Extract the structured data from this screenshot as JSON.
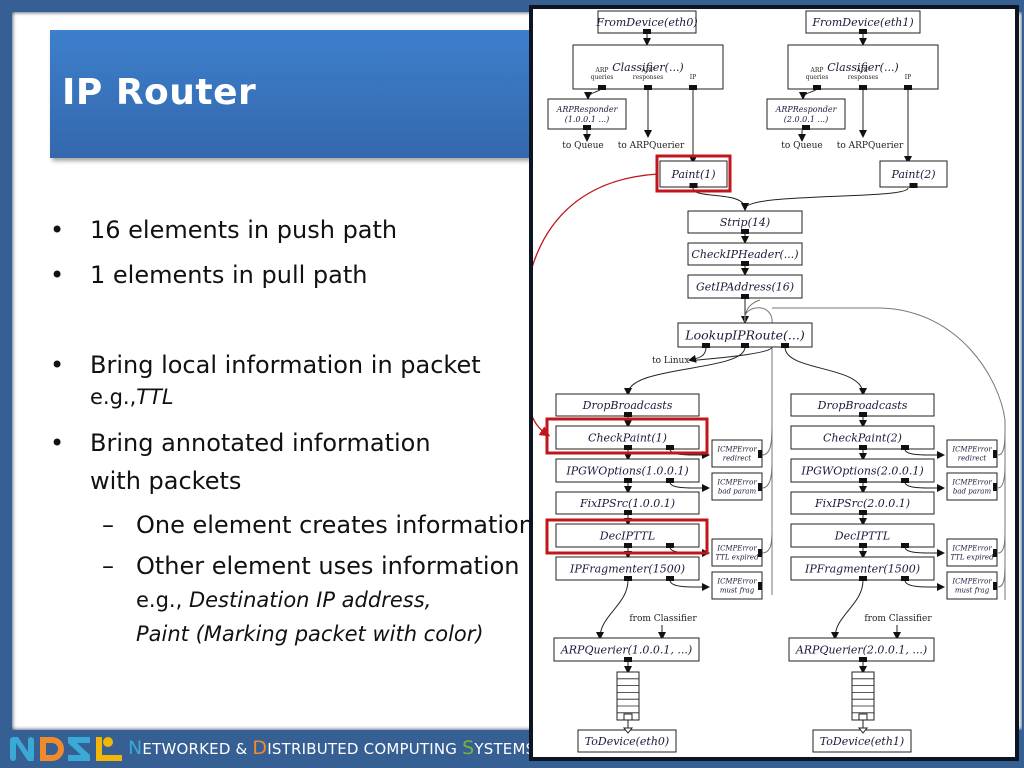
{
  "slide": {
    "title": "IP Router",
    "bullets": [
      {
        "text": "16 elements in push path"
      },
      {
        "text": "1 elements in pull path"
      },
      {
        "text": "Bring local information in packet",
        "example_prefix": "e.g.,",
        "example": "TTL"
      },
      {
        "text_line1": "Bring annotated information",
        "text_line2": "with packets"
      }
    ],
    "sub_bullets": [
      {
        "text": "One element creates information"
      },
      {
        "text": "Other element uses information",
        "example_prefix": "e.g.,",
        "example_line1": "Destination IP address,",
        "example_line2": "Paint (Marking packet with color)"
      }
    ],
    "bullet_char": "•",
    "dash_char": "–"
  },
  "footer": {
    "logo_text": "NDSL",
    "lab_name_parts": [
      {
        "initial": "N",
        "rest": "ETWORKED & ",
        "color": "#3aa9d6"
      },
      {
        "initial": "D",
        "rest": "ISTRIBUTED COMPUTING ",
        "color": "#f08a2a"
      },
      {
        "initial": "S",
        "rest": "YSTEMS ",
        "color": "#7bb33a"
      },
      {
        "initial": "L",
        "rest": "",
        "color": "#f2b705"
      }
    ],
    "logo_colors": [
      "#3aa9d6",
      "#f08a2a",
      "#3aa9d6",
      "#f2b705"
    ]
  },
  "diagram": {
    "highlight_color": "#c0161c",
    "left": {
      "from_device": "FromDevice(eth0)",
      "classifier": "Classifier(...)",
      "classifier_ports": [
        "ARP queries",
        "ARP responses",
        "IP"
      ],
      "arp_responder": [
        "ARPResponder",
        "(1.0.0.1 ...)"
      ],
      "to_queue": "to Queue",
      "to_arpquerier": "to ARPQuerier",
      "paint": "Paint(1)",
      "drop_broadcasts": "DropBroadcasts",
      "check_paint": "CheckPaint(1)",
      "ipgw_options": "IPGWOptions(1.0.0.1)",
      "fix_ip_src": "FixIPSrc(1.0.0.1)",
      "dec_ip_ttl": "DecIPTTL",
      "ip_fragmenter": "IPFragmenter(1500)",
      "icmp_errors": [
        [
          "ICMPError",
          "redirect"
        ],
        [
          "ICMPError",
          "bad param"
        ],
        [
          "ICMPError",
          "TTL expired"
        ],
        [
          "ICMPError",
          "must frag"
        ]
      ],
      "from_classifier": "from Classifier",
      "arp_querier": "ARPQuerier(1.0.0.1, ...)",
      "to_device": "ToDevice(eth0)"
    },
    "right": {
      "from_device": "FromDevice(eth1)",
      "classifier": "Classifier(...)",
      "classifier_ports": [
        "ARP queries",
        "ARP responses",
        "IP"
      ],
      "arp_responder": [
        "ARPResponder",
        "(2.0.0.1 ...)"
      ],
      "to_queue": "to Queue",
      "to_arpquerier": "to ARPQuerier",
      "paint": "Paint(2)",
      "drop_broadcasts": "DropBroadcasts",
      "check_paint": "CheckPaint(2)",
      "ipgw_options": "IPGWOptions(2.0.0.1)",
      "fix_ip_src": "FixIPSrc(2.0.0.1)",
      "dec_ip_ttl": "DecIPTTL",
      "ip_fragmenter": "IPFragmenter(1500)",
      "icmp_errors": [
        [
          "ICMPError",
          "redirect"
        ],
        [
          "ICMPError",
          "bad param"
        ],
        [
          "ICMPError",
          "TTL expired"
        ],
        [
          "ICMPError",
          "must frag"
        ]
      ],
      "from_classifier": "from Classifier",
      "arp_querier": "ARPQuerier(2.0.0.1, ...)",
      "to_device": "ToDevice(eth1)"
    },
    "shared": {
      "strip": "Strip(14)",
      "check_ip_header": "CheckIPHeader(...)",
      "get_ip_address": "GetIPAddress(16)",
      "lookup_ip_route": "LookupIPRoute(...)",
      "to_linux": "to Linux"
    }
  }
}
